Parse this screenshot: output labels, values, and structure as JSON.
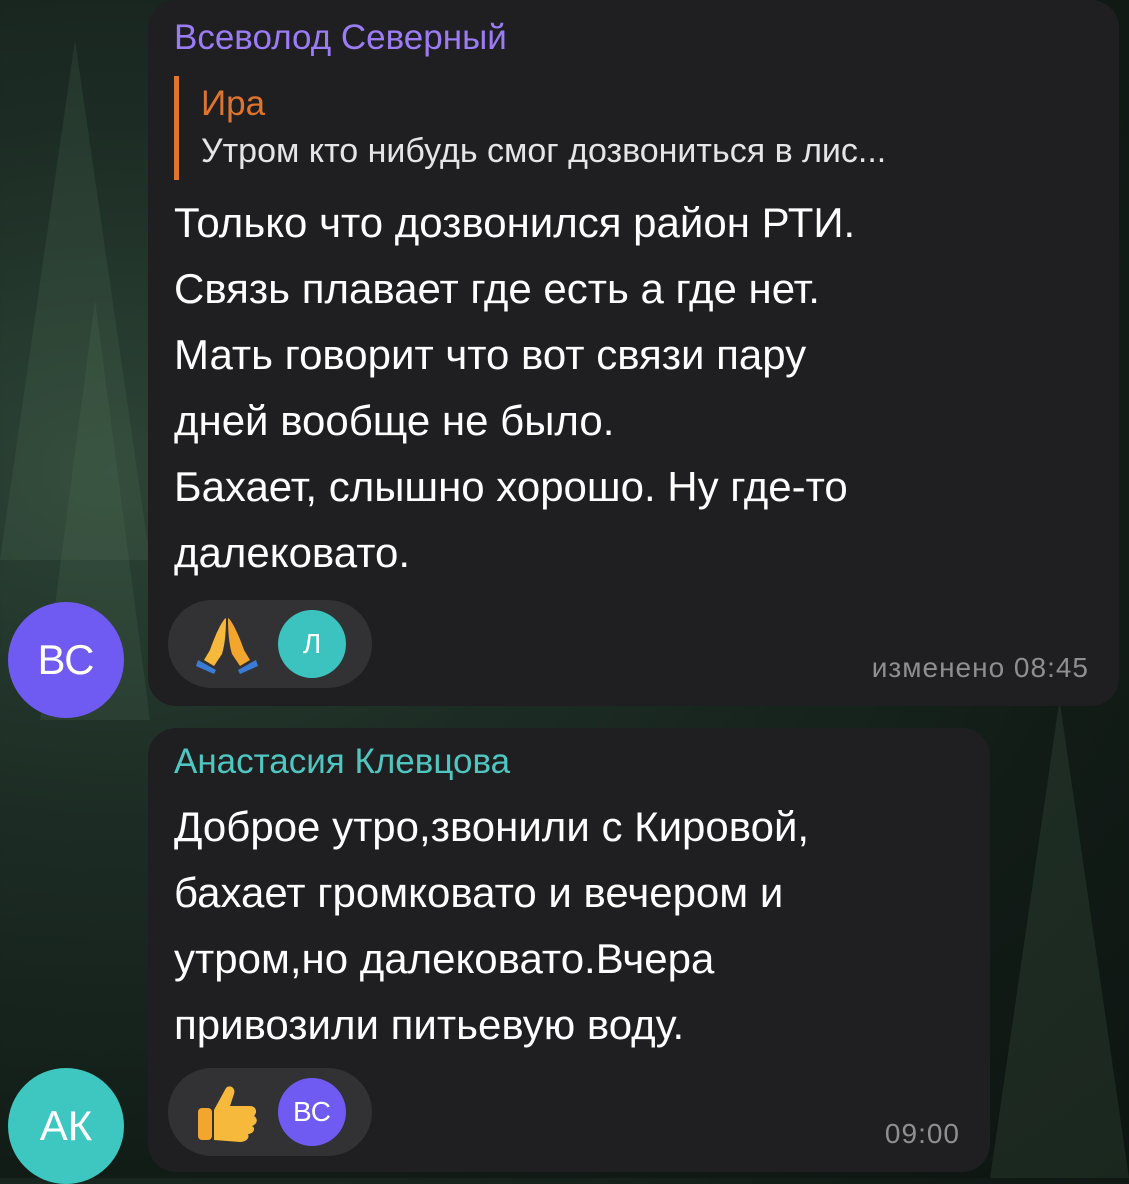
{
  "messages": [
    {
      "sender": "Всеволод Северный",
      "sender_color": "#9b7cf5",
      "avatar_initials": "ВС",
      "avatar_color": "#6f5af2",
      "reply": {
        "name": "Ира",
        "name_color": "#e0742d",
        "text": "Утром кто нибудь смог дозвониться в лис..."
      },
      "lines": [
        "Только что дозвонился район РТИ.",
        "Связь плавает где есть а где нет.",
        "Мать говорит что вот связи пару",
        "дней вообще не было.",
        "Бахает, слышно хорошо. Ну где-то",
        "далековато."
      ],
      "reaction": {
        "emoji": "folded-hands-icon",
        "user_initials": "Л",
        "user_color": "#3cc3bf"
      },
      "time": "изменено 08:45"
    },
    {
      "sender": "Анастасия Клевцова",
      "sender_color": "#4fc6c0",
      "avatar_initials": "АК",
      "avatar_color": "#3dc7c0",
      "lines": [
        "Доброе утро,звонили с Кировой,",
        "бахает громковато и вечером и",
        "утром,но далековато.Вчера",
        "привозили питьевую воду."
      ],
      "reaction": {
        "emoji": "thumbs-up-icon",
        "user_initials": "ВС",
        "user_color": "#6f5af2"
      },
      "time": "09:00"
    }
  ]
}
